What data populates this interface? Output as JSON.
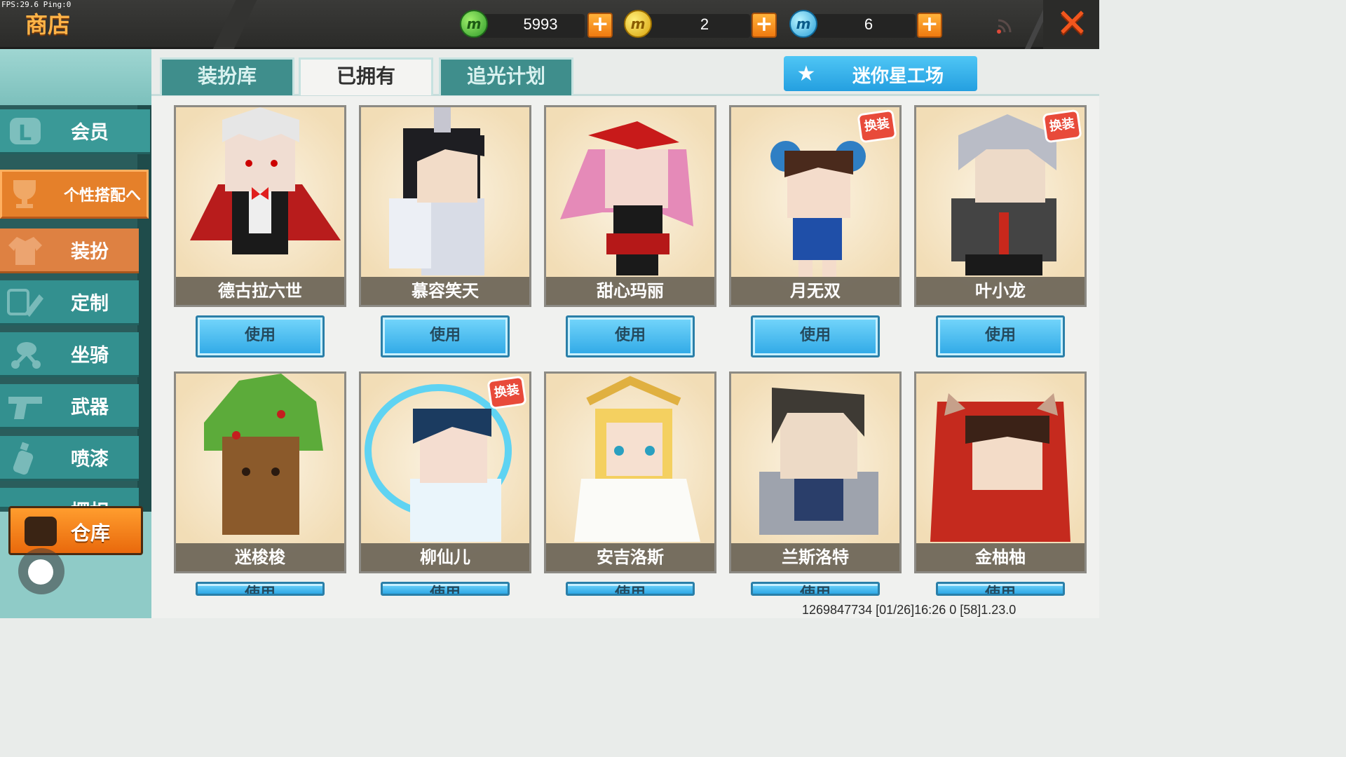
{
  "debug": {
    "fps_text": "FPS:29.6  Ping:0"
  },
  "header": {
    "title": "商店",
    "currencies": [
      {
        "name": "mini-bean",
        "icon": "m",
        "value": "5993"
      },
      {
        "name": "mini-coin",
        "icon": "m",
        "value": "2"
      },
      {
        "name": "mini-point",
        "icon": "m",
        "value": "6"
      }
    ],
    "add_label": "+",
    "close_label": "✕"
  },
  "sidebar": {
    "items": [
      {
        "label": "会员"
      },
      {
        "label": "个性搭配へ"
      },
      {
        "label": "装扮"
      },
      {
        "label": "定制"
      },
      {
        "label": "坐骑"
      },
      {
        "label": "武器"
      },
      {
        "label": "喷漆"
      },
      {
        "label": "摆相"
      }
    ],
    "warehouse_label": "仓库"
  },
  "tabs": [
    {
      "label": "装扮库"
    },
    {
      "label": "已拥有"
    },
    {
      "label": "追光计划"
    }
  ],
  "workshop": {
    "label": "迷你星工场"
  },
  "skins": [
    {
      "name": "德古拉六世",
      "badge": "",
      "button": "使用"
    },
    {
      "name": "慕容笑天",
      "badge": "",
      "button": "使用"
    },
    {
      "name": "甜心玛丽",
      "badge": "",
      "button": "使用"
    },
    {
      "name": "月无双",
      "badge": "换装",
      "button": "使用"
    },
    {
      "name": "叶小龙",
      "badge": "换装",
      "button": "使用"
    },
    {
      "name": "迷梭梭",
      "badge": "",
      "button": "使用"
    },
    {
      "name": "柳仙儿",
      "badge": "换装",
      "button": "使用"
    },
    {
      "name": "安吉洛斯",
      "badge": "",
      "button": "使用"
    },
    {
      "name": "兰斯洛特",
      "badge": "",
      "button": "使用"
    },
    {
      "name": "金柚柚",
      "badge": "",
      "button": "使用"
    }
  ],
  "footer": {
    "info": "1269847734  [01/26]16:26 0  [58]1.23.0"
  },
  "colors": {
    "accent_orange": "#e5802a",
    "sidebar_teal": "#33908f",
    "button_blue": "#2ea8e6",
    "close_red": "#f2561d"
  }
}
